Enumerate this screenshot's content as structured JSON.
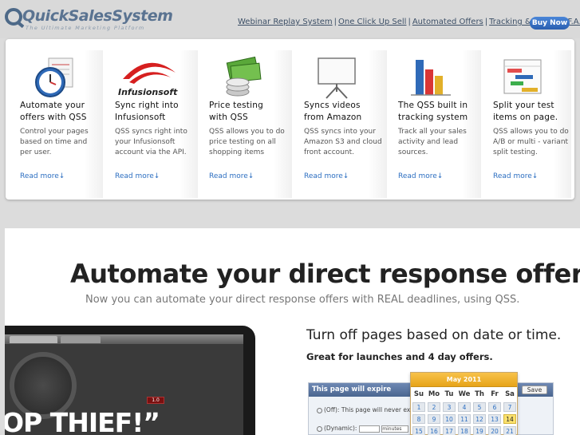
{
  "header": {
    "logo_text": "QuickSalesSystem",
    "logo_tagline": "The Ultimate Marketing Platform",
    "nav": [
      {
        "label": "Webinar Replay System"
      },
      {
        "label": "One Click Up Sell"
      },
      {
        "label": "Automated Offers"
      },
      {
        "label": "Tracking & Testing"
      },
      {
        "label": "F.A.Q"
      }
    ],
    "buy_label": "Buy Now"
  },
  "features": [
    {
      "icon": "clock-calendar-icon",
      "title_1": "Automate your",
      "title_2": "offers with QSS",
      "body": "Control your pages based on time and per user.",
      "link": "Read more↓"
    },
    {
      "icon": "infusionsoft-logo-icon",
      "title_1": "Sync right into",
      "title_2": "Infusionsoft",
      "body": "QSS syncs right into your Infusionsoft account via the API.",
      "link": "Read more↓"
    },
    {
      "icon": "money-coins-icon",
      "title_1": "Price testing",
      "title_2": "with QSS",
      "body": "QSS allows you to do price testing on all shopping items",
      "link": "Read more↓"
    },
    {
      "icon": "presentation-board-icon",
      "title_1": "Syncs videos",
      "title_2": "from Amazon",
      "body": "QSS syncs into your Amazon S3 and cloud front account.",
      "link": "Read more↓"
    },
    {
      "icon": "bar-chart-icon",
      "title_1": "The QSS built in",
      "title_2": "tracking system",
      "body": "Track all your sales activity and lead sources.",
      "link": "Read more↓"
    },
    {
      "icon": "gantt-chart-icon",
      "title_1": "Split your test",
      "title_2": "items on page.",
      "body": "QSS allows you to do A/B or multi - variant split testing.",
      "link": "Read more↓"
    }
  ],
  "main": {
    "headline": "Automate your direct response offers.",
    "subhead": "Now you can automate your direct response offers with REAL deadlines, using QSS.",
    "device_text": "OP THIEF!”",
    "device_red_label": "1.0",
    "side_title": "Turn off pages based on date or time.",
    "side_sub": "Great for launches and 4 day offers.",
    "widget": {
      "title": "This page will expire",
      "save": "Save",
      "row1": "(Off): This page will never expire",
      "row2": "(Dynamic):",
      "row2_unit": "minutes"
    },
    "calendar": {
      "month": "May 2011",
      "dow": [
        "Su",
        "Mo",
        "Tu",
        "We",
        "Th",
        "Fr",
        "Sa"
      ],
      "week1": [
        "1",
        "2",
        "3",
        "4",
        "5",
        "6",
        "7"
      ],
      "week2": [
        "8",
        "9",
        "10",
        "11",
        "12",
        "13",
        "14"
      ],
      "week3": [
        "15",
        "16",
        "17",
        "18",
        "19",
        "20",
        "21"
      ],
      "today": "14"
    }
  },
  "colors": {
    "link": "#2d6fc1",
    "buy_button": "#2a5fb0",
    "calendar_header": "#e7a419",
    "widget_header": "#4a6690"
  }
}
